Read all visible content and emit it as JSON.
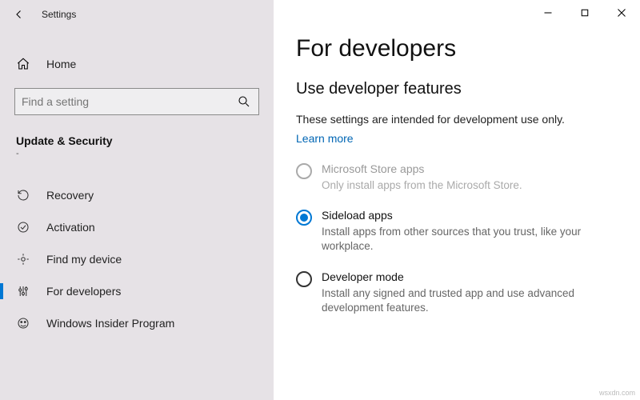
{
  "titlebar": {
    "title": "Settings"
  },
  "sidebar": {
    "home_label": "Home",
    "search_placeholder": "Find a setting",
    "category": "Update & Security",
    "dash": "-",
    "items": [
      {
        "label": "Recovery"
      },
      {
        "label": "Activation"
      },
      {
        "label": "Find my device"
      },
      {
        "label": "For developers"
      },
      {
        "label": "Windows Insider Program"
      }
    ]
  },
  "main": {
    "heading": "For developers",
    "subheading": "Use developer features",
    "intro": "These settings are intended for development use only.",
    "learn_more": "Learn more",
    "options": [
      {
        "label": "Microsoft Store apps",
        "description": "Only install apps from the Microsoft Store."
      },
      {
        "label": "Sideload apps",
        "description": "Install apps from other sources that you trust, like your workplace."
      },
      {
        "label": "Developer mode",
        "description": "Install any signed and trusted app and use advanced development features."
      }
    ]
  },
  "watermark": "wsxdn.com"
}
